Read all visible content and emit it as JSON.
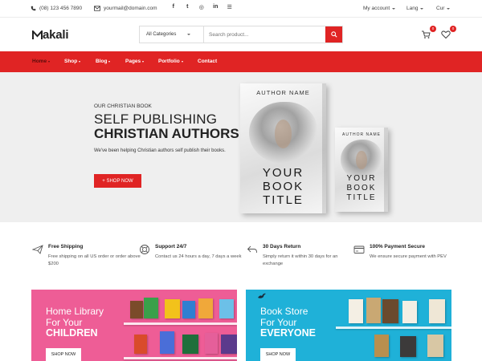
{
  "topbar": {
    "phone": "(08) 123 456 7890",
    "email": "yourmail@domain.com",
    "social_icons": [
      "facebook-icon",
      "twitter-icon",
      "instagram-icon",
      "linkedin-icon",
      "rss-icon"
    ],
    "social_glyphs": [
      "f",
      "t",
      "◎",
      "in",
      "☰"
    ],
    "account": "My account",
    "lang": "Lang",
    "currency": "Cur"
  },
  "header": {
    "logo": "akali",
    "search": {
      "category": "All Categories",
      "placeholder": "Search product..."
    },
    "cart_count": "0",
    "wishlist_count": "0"
  },
  "nav": {
    "items": [
      {
        "label": "Home",
        "dropdown": true,
        "active": true
      },
      {
        "label": "Shop",
        "dropdown": true
      },
      {
        "label": "Blog",
        "dropdown": true
      },
      {
        "label": "Pages",
        "dropdown": true
      },
      {
        "label": "Portfolio",
        "dropdown": true
      },
      {
        "label": "Contact",
        "dropdown": false
      }
    ]
  },
  "hero": {
    "eyebrow": "OUR CHRISTIAN BOOK",
    "title_line1": "SELF PUBLISHING",
    "title_line2": "CHRISTIAN AUTHORS",
    "description": "We've been helping Christian authors self publish their books.",
    "cta": "+ SHOP NOW",
    "book_large": {
      "author": "AUTHOR NAME",
      "title_l1": "YOUR",
      "title_l2": "BOOK",
      "title_l3": "TITLE"
    },
    "book_small": {
      "author": "AUTHOR NAME",
      "title_l1": "YOUR",
      "title_l2": "BOOK",
      "title_l3": "TITLE"
    }
  },
  "features": [
    {
      "icon": "airplane-icon",
      "title": "Free Shipping",
      "text": "Free shipping on all US order or order above $200"
    },
    {
      "icon": "lifebuoy-icon",
      "title": "Support 24/7",
      "text": "Contact us 24 hours a day, 7 days a week"
    },
    {
      "icon": "return-arrow-icon",
      "title": "30 Days Return",
      "text": "Simply return it within 30 days for an exchange"
    },
    {
      "icon": "card-icon",
      "title": "100% Payment Secure",
      "text": "We ensure secure payment with PEV"
    }
  ],
  "banners": [
    {
      "line1": "Home Library",
      "line2": "For Your",
      "line3": "CHILDREN",
      "button": "SHOP NOW",
      "bg": "#ee5d96"
    },
    {
      "line1": "Book Store",
      "line2": "For Your",
      "line3": "EVERYONE",
      "button": "SHOP NOW",
      "bg": "#1fb1d8"
    }
  ],
  "colors": {
    "accent": "#e02424",
    "hero_bg": "#efefef"
  }
}
